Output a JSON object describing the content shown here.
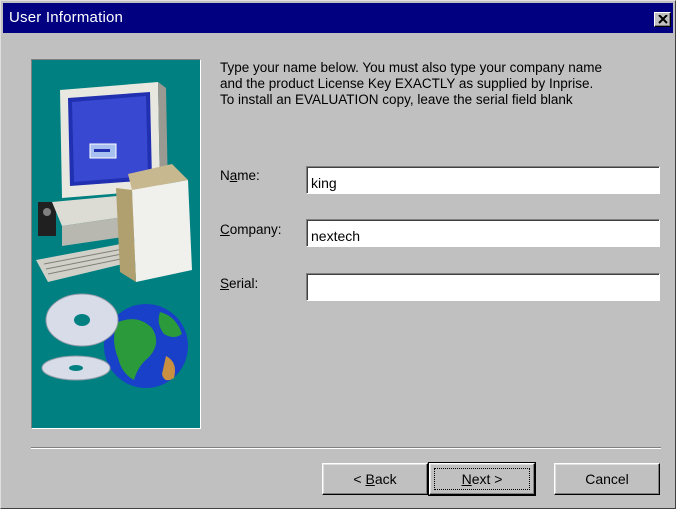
{
  "window": {
    "title": "User Information"
  },
  "instructions": "Type your name below. You must also type your company name\nand the product License Key EXACTLY as supplied by Inprise.\nTo install an EVALUATION copy, leave the serial field blank",
  "fields": [
    {
      "label_pre": "N",
      "label_key": "a",
      "label_post": "me:",
      "value": ""
    },
    {
      "label_pre": "",
      "label_key": "C",
      "label_post": "ompany:",
      "value": ""
    },
    {
      "label_pre": "",
      "label_key": "S",
      "label_post": "erial:",
      "value": ""
    }
  ],
  "field_values": {
    "name": "king",
    "company": "nextech",
    "serial": ""
  },
  "buttons": {
    "back": {
      "pre": "< ",
      "key": "B",
      "post": "ack"
    },
    "next": {
      "pre": "",
      "key": "N",
      "post": "ext >"
    },
    "cancel": "Cancel"
  },
  "colors": {
    "title_bar": "#000080",
    "dialog_face": "#c0c0c0",
    "art_background": "#008080"
  }
}
